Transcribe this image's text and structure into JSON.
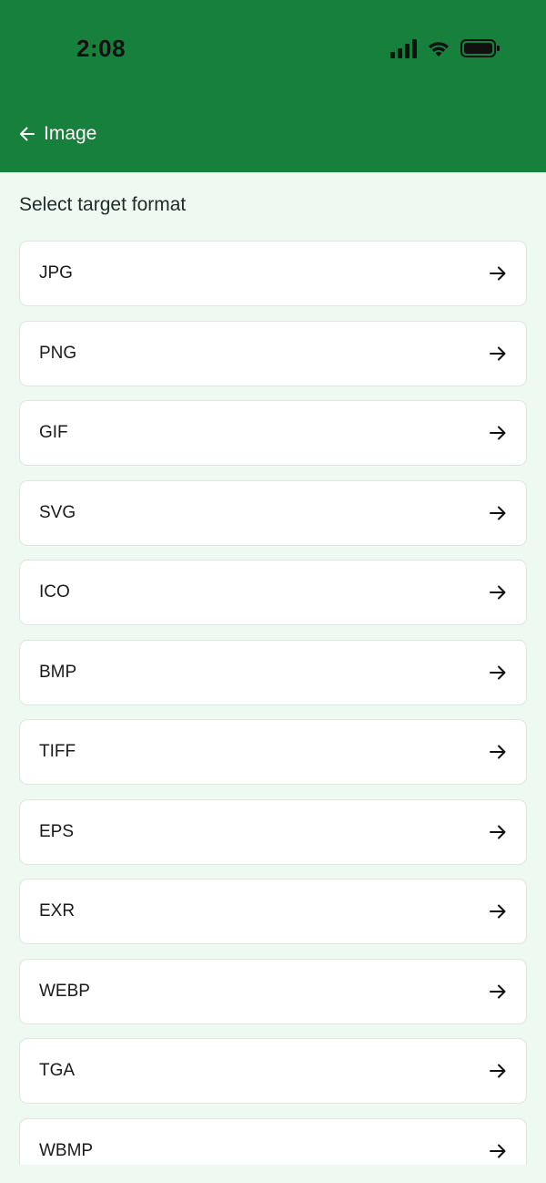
{
  "status_bar": {
    "time": "2:08"
  },
  "nav": {
    "back_title": "Image"
  },
  "section": {
    "label": "Select target format"
  },
  "formats": [
    "JPG",
    "PNG",
    "GIF",
    "SVG",
    "ICO",
    "BMP",
    "TIFF",
    "EPS",
    "EXR",
    "WEBP",
    "TGA",
    "WBMP"
  ],
  "colors": {
    "header_bg": "#17803d",
    "page_bg": "#eefaf1",
    "card_bg": "#ffffff"
  },
  "icons": {
    "back": "arrow-left-icon",
    "row": "arrow-right-icon"
  }
}
